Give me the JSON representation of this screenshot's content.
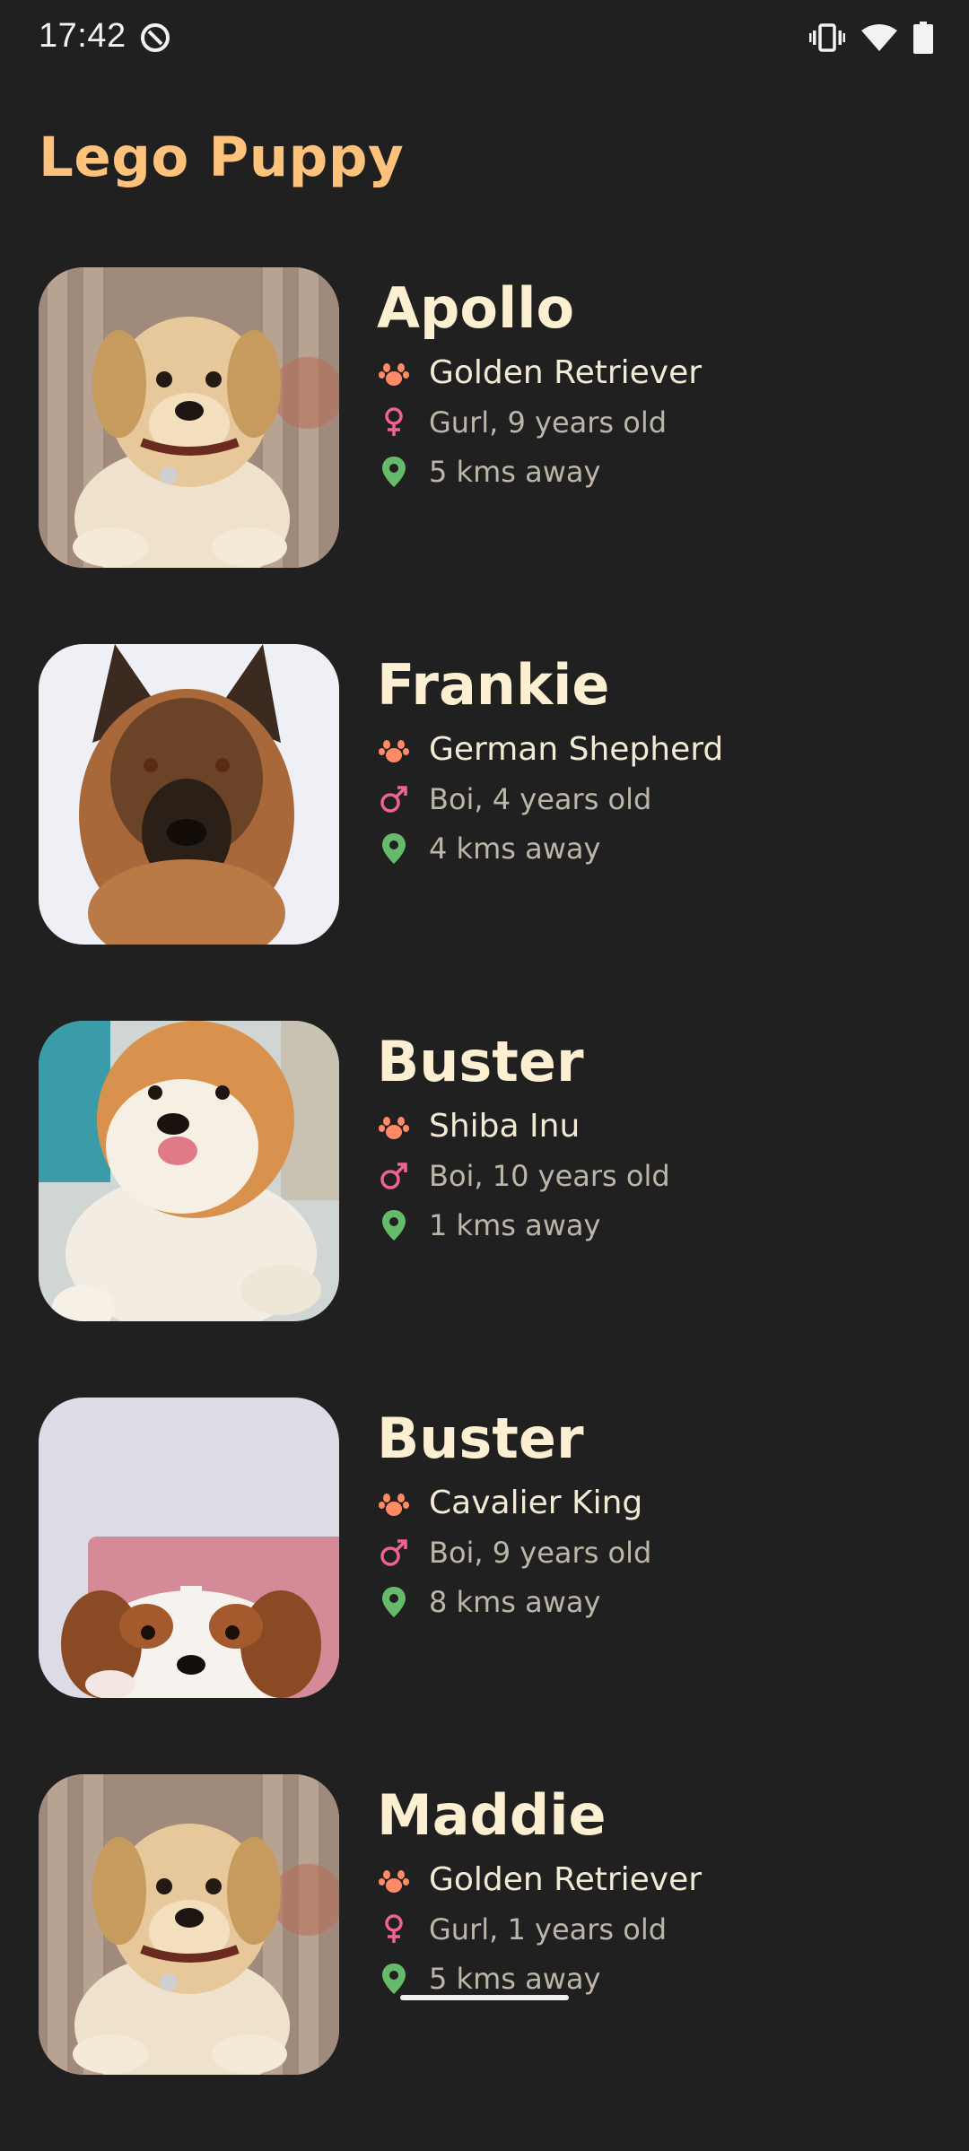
{
  "status_bar": {
    "time": "17:42",
    "icons": [
      "do-not-disturb-icon",
      "vibrate-icon",
      "wifi-icon",
      "battery-icon"
    ]
  },
  "app": {
    "title": "Lego Puppy"
  },
  "colors": {
    "background": "#202020",
    "title": "#ffc27a",
    "name": "#fdf0d2",
    "paw_icon": "#ff8a65",
    "gender_icon": "#f06292",
    "location_icon": "#66bb6a"
  },
  "puppies": [
    {
      "name": "Apollo",
      "breed": "Golden Retriever",
      "gender": "female",
      "gender_age": "Gurl, 9 years old",
      "distance": "5 kms away",
      "photo": "golden-retriever-photo"
    },
    {
      "name": "Frankie",
      "breed": "German Shepherd",
      "gender": "male",
      "gender_age": "Boi, 4 years old",
      "distance": "4 kms away",
      "photo": "german-shepherd-photo"
    },
    {
      "name": "Buster",
      "breed": "Shiba Inu",
      "gender": "male",
      "gender_age": "Boi, 10 years old",
      "distance": "1 kms away",
      "photo": "shiba-inu-photo"
    },
    {
      "name": "Buster",
      "breed": "Cavalier King",
      "gender": "male",
      "gender_age": "Boi, 9 years old",
      "distance": "8 kms away",
      "photo": "cavalier-king-photo"
    },
    {
      "name": "Maddie",
      "breed": "Golden Retriever",
      "gender": "female",
      "gender_age": "Gurl, 1 years old",
      "distance": "5 kms away",
      "photo": "golden-retriever-photo"
    }
  ]
}
